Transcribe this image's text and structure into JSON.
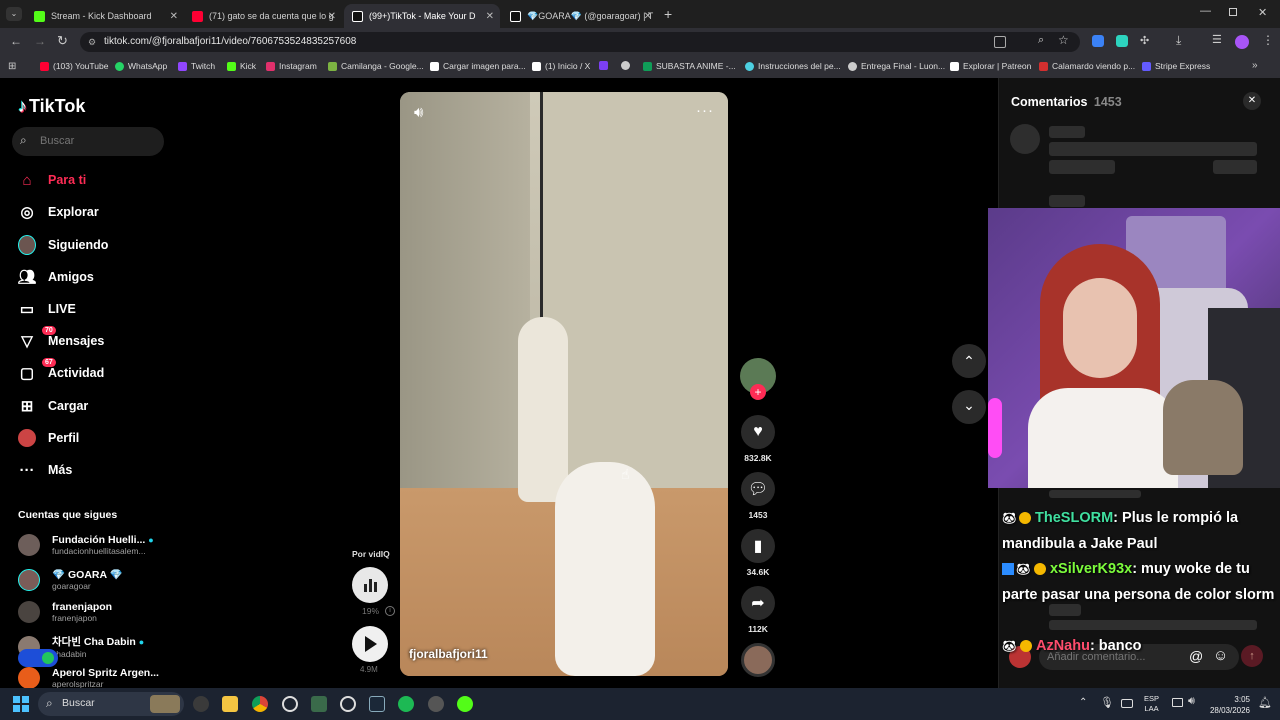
{
  "browser": {
    "tabs": [
      {
        "title": "Stream - Kick Dashboard",
        "color": "#53fc18"
      },
      {
        "title": "(71) gato se da cuenta que lo g",
        "color": "#ff0033"
      },
      {
        "title": "(99+)TikTok - Make Your D",
        "color": "#ffffff"
      },
      {
        "title": "💎GOARA💎 (@goaragoar) | T",
        "color": "#ffffff"
      }
    ],
    "new_tab": "+",
    "url": "tiktok.com/@fjoralbafjori11/video/7606753524835257608",
    "bookmarks": [
      {
        "label": "(103) YouTube",
        "color": "#ff0033"
      },
      {
        "label": "WhatsApp",
        "color": "#25d366"
      },
      {
        "label": "Twitch",
        "color": "#9146ff"
      },
      {
        "label": "Kick",
        "color": "#53fc18"
      },
      {
        "label": "Instagram",
        "color": "#e1306c"
      },
      {
        "label": "Camilanga - Google...",
        "color": "#7cb342"
      },
      {
        "label": "Cargar imagen para...",
        "color": "#ffffff"
      },
      {
        "label": "(1) Inicio / X",
        "color": "#ffffff"
      },
      {
        "label": "",
        "color": "#7b3ff2"
      },
      {
        "label": "",
        "color": "#cccccc"
      },
      {
        "label": "SUBASTA ANIME -...",
        "color": "#0f9d58"
      },
      {
        "label": "Instrucciones del pe...",
        "color": "#4dd0e1"
      },
      {
        "label": "Entrega Final - Luon...",
        "color": "#cccccc"
      },
      {
        "label": "Explorar | Patreon",
        "color": "#ffffff"
      },
      {
        "label": "Calamardo viendo p...",
        "color": "#d32f2f"
      },
      {
        "label": "Stripe Express",
        "color": "#635bff"
      }
    ]
  },
  "tiktok": {
    "logo": "TikTok",
    "search_placeholder": "Buscar",
    "nav": [
      {
        "label": "Para ti",
        "icon": "home-icon",
        "active": true
      },
      {
        "label": "Explorar",
        "icon": "compass-icon"
      },
      {
        "label": "Siguiendo",
        "icon": "avatar-icon"
      },
      {
        "label": "Amigos",
        "icon": "friends-icon"
      },
      {
        "label": "LIVE",
        "icon": "live-icon"
      },
      {
        "label": "Mensajes",
        "icon": "messages-icon",
        "badge": "70"
      },
      {
        "label": "Actividad",
        "icon": "activity-icon",
        "badge": "67"
      },
      {
        "label": "Cargar",
        "icon": "upload-icon"
      },
      {
        "label": "Perfil",
        "icon": "profile-icon"
      },
      {
        "label": "Más",
        "icon": "more-icon"
      }
    ],
    "following_title": "Cuentas que sigues",
    "following": [
      {
        "name": "Fundación Huelli...",
        "handle": "fundacionhuellitasalem..."
      },
      {
        "name": "💎 GOARA 💎",
        "handle": "goaragoar"
      },
      {
        "name": "franenjapon",
        "handle": "franenjapon"
      },
      {
        "name": "차다빈 Cha Dabin",
        "handle": "chadabin"
      },
      {
        "name": "Aperol Spritz Argen...",
        "handle": "aperolspritzar"
      }
    ],
    "vidiq": {
      "label": "Por vidIQ",
      "percent": "19%",
      "views": "4.9M"
    },
    "video": {
      "username": "fjoralbafjori11"
    },
    "actions": {
      "likes": "832.8K",
      "comments": "1453",
      "saves": "34.6K",
      "shares": "112K"
    },
    "comments_panel": {
      "title": "Comentarios",
      "count": "1453",
      "add_placeholder": "Añadir comentario..."
    }
  },
  "chat": [
    {
      "user": "TheSLORM",
      "user_color": "#40e0a0",
      "message": ": Plus le rompió la mandibula a Jake Paul"
    },
    {
      "user": "xSilverK93x",
      "user_color": "#7cfc3c",
      "message": ": muy woke de tu parte pasar una persona de color slorm"
    },
    {
      "user": "AzNahu",
      "user_color": "#ff4d6d",
      "message": ": banco"
    }
  ],
  "taskbar": {
    "search": "Buscar",
    "lang_top": "ESP",
    "lang_bottom": "LAA",
    "time": "3:05",
    "date": "28/03/2026"
  }
}
